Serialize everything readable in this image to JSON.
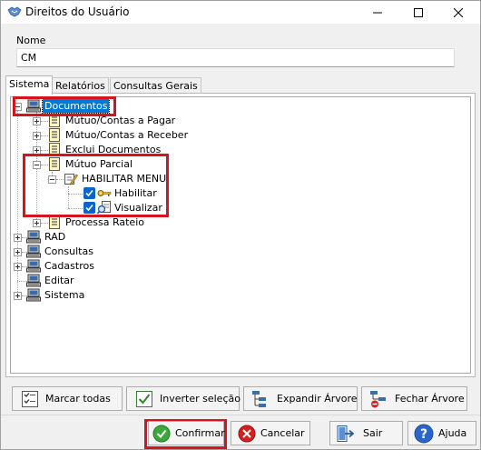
{
  "window": {
    "title": "Direitos do Usuário"
  },
  "form": {
    "name_label": "Nome",
    "name_value": "CM"
  },
  "tabs": [
    {
      "label": "Sistema",
      "active": true
    },
    {
      "label": "Relatórios",
      "active": false
    },
    {
      "label": "Consultas Gerais",
      "active": false
    }
  ],
  "tree": {
    "documentos": "Documentos",
    "mutuo_pagar": "Mútuo/Contas a Pagar",
    "mutuo_receber": "Mútuo/Contas a Receber",
    "exclui_documentos": "Exclui Documentos",
    "mutuo_parcial": "Mútuo Parcial",
    "habilitar_menu": "HABILITAR MENU",
    "habilitar": "Habilitar",
    "visualizar": "Visualizar",
    "processa_rateio": "Processa Rateio",
    "rad": "RAD",
    "consultas": "Consultas",
    "cadastros": "Cadastros",
    "editar": "Editar",
    "sistema": "Sistema"
  },
  "actions": {
    "marcar_todas": "Marcar todas",
    "inverter_selecao": "Inverter seleção",
    "expandir_arvore": "Expandir Árvore",
    "fechar_arvore": "Fechar Árvore"
  },
  "footer": {
    "confirmar": "Confirmar",
    "cancelar": "Cancelar",
    "sair": "Sair",
    "ajuda": "Ajuda"
  },
  "colors": {
    "selection": "#0078d7",
    "highlight": "#d7141c",
    "checkbox": "#0a64d0"
  }
}
